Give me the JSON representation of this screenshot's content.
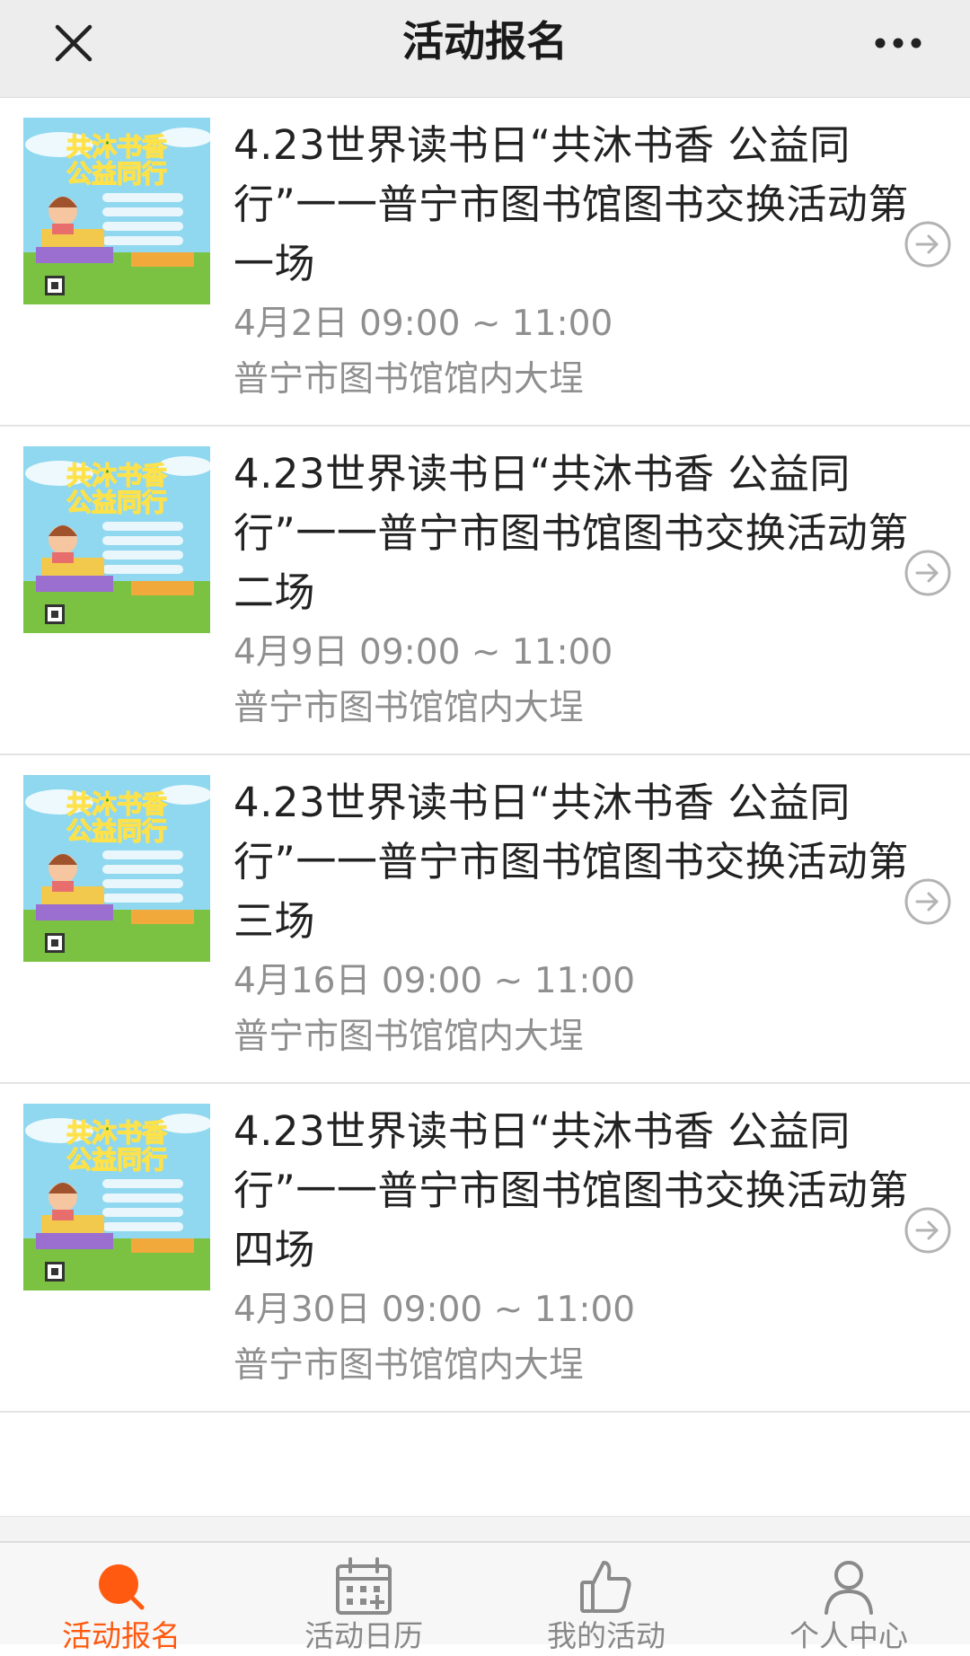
{
  "header": {
    "title": "活动报名"
  },
  "events": [
    {
      "title": "4.23世界读书日“共沐书香 公益同行”一一普宁市图书馆图书交换活动第一场",
      "date": "4月2日 09:00 ~ 11:00",
      "location": "普宁市图书馆馆内大埕"
    },
    {
      "title": "4.23世界读书日“共沐书香 公益同行”一一普宁市图书馆图书交换活动第二场",
      "date": "4月9日 09:00 ~ 11:00",
      "location": "普宁市图书馆馆内大埕"
    },
    {
      "title": "4.23世界读书日“共沐书香 公益同行”一一普宁市图书馆图书交换活动第三场",
      "date": "4月16日 09:00 ~ 11:00",
      "location": "普宁市图书馆馆内大埕"
    },
    {
      "title": "4.23世界读书日“共沐书香 公益同行”一一普宁市图书馆图书交换活动第四场",
      "date": "4月30日 09:00 ~ 11:00",
      "location": "普宁市图书馆馆内大埕"
    }
  ],
  "poster": {
    "headline_top": "共沐书香",
    "headline_bottom": "公益同行"
  },
  "tabbar": {
    "tabs": [
      {
        "label": "活动报名",
        "icon": "activity-signup-icon",
        "active": true
      },
      {
        "label": "活动日历",
        "icon": "calendar-icon",
        "active": false
      },
      {
        "label": "我的活动",
        "icon": "thumbs-up-icon",
        "active": false
      },
      {
        "label": "个人中心",
        "icon": "person-icon",
        "active": false
      }
    ]
  },
  "colors": {
    "accent": "#ff5a10",
    "header_bg": "#ededed",
    "muted_text": "#8f8f8f"
  }
}
